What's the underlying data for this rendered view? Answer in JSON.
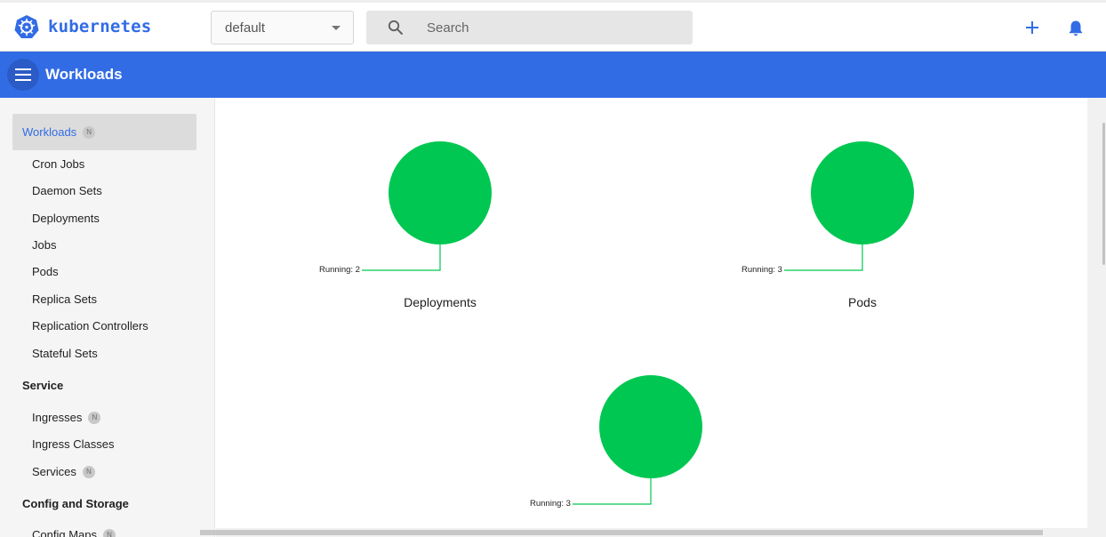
{
  "brand": {
    "name": "kubernetes",
    "color": "#326ce5"
  },
  "topbar": {
    "namespace": "default",
    "search_placeholder": "Search",
    "icons": [
      "kubernetes-logo-icon",
      "chevron-down-icon",
      "search-icon",
      "plus-icon",
      "bell-icon"
    ]
  },
  "header": {
    "title": "Workloads",
    "color": "#326ce5"
  },
  "sidebar": {
    "active": {
      "label": "Workloads",
      "badge": "N"
    },
    "workload_items": [
      {
        "label": "Cron Jobs"
      },
      {
        "label": "Daemon Sets"
      },
      {
        "label": "Deployments"
      },
      {
        "label": "Jobs"
      },
      {
        "label": "Pods"
      },
      {
        "label": "Replica Sets"
      },
      {
        "label": "Replication Controllers"
      },
      {
        "label": "Stateful Sets"
      }
    ],
    "service_group": "Service",
    "service_items": [
      {
        "label": "Ingresses",
        "badge": "N"
      },
      {
        "label": "Ingress Classes"
      },
      {
        "label": "Services",
        "badge": "N"
      }
    ],
    "config_group": "Config and Storage",
    "config_items": [
      {
        "label": "Config Maps",
        "badge": "N"
      }
    ]
  },
  "chart_data": [
    {
      "type": "pie",
      "title": "Deployments",
      "slices": [
        {
          "label": "Running",
          "value": 2,
          "color": "#00c752"
        }
      ],
      "annotation": "Running: 2"
    },
    {
      "type": "pie",
      "title": "Pods",
      "slices": [
        {
          "label": "Running",
          "value": 3,
          "color": "#00c752"
        }
      ],
      "annotation": "Running: 3"
    },
    {
      "type": "pie",
      "title": "",
      "slices": [
        {
          "label": "Running",
          "value": 3,
          "color": "#00c752"
        }
      ],
      "annotation": "Running: 3"
    }
  ]
}
